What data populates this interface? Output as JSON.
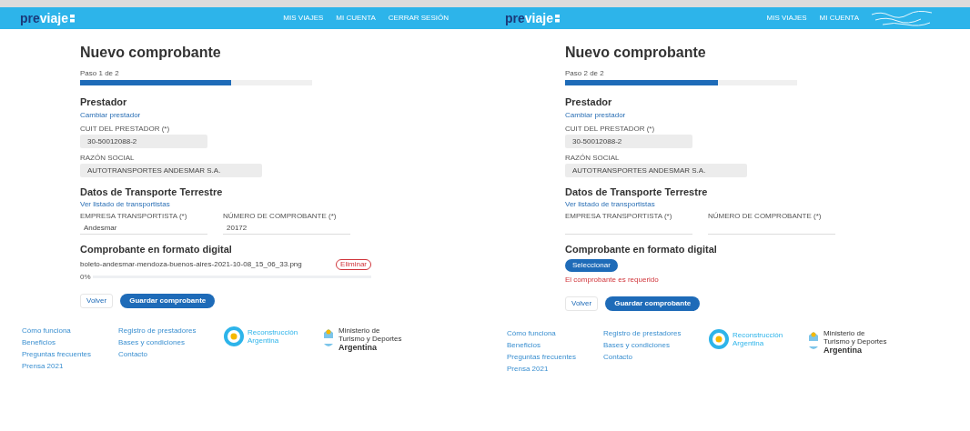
{
  "screens": [
    {
      "logo": {
        "prefix": "pre",
        "name": "viaje"
      },
      "nav": [
        {
          "label": "MIS VIAJES"
        },
        {
          "label": "MI CUENTA"
        },
        {
          "label": "CERRAR SESIÓN"
        }
      ],
      "nav_decoration": false,
      "title": "Nuevo comprobante",
      "step": {
        "label": "Paso 1 de 2",
        "level": 0.65
      },
      "provider": {
        "heading": "Prestador",
        "link": "Cambiar prestador",
        "fields": [
          {
            "label": "CUIT DEL PRESTADOR (*)",
            "value": "30-50012088-2"
          },
          {
            "label": "RAZÓN SOCIAL",
            "value": "AUTOTRANSPORTES ANDESMAR S.A."
          }
        ]
      },
      "transport": {
        "heading": "Datos de Transporte Terrestre",
        "link": "Ver listado de transportistas",
        "fields": [
          {
            "label": "EMPRESA TRANSPORTISTA (*)",
            "value": "Andesmar"
          },
          {
            "label": "NÚMERO DE COMPROBANTE (*)",
            "value": "20172"
          }
        ]
      },
      "digital": {
        "heading": "Comprobante en formato digital",
        "kind": "file",
        "file_name": "boleto-andesmar-mendoza-buenos-aires-2021-10-08_15_06_33.png",
        "remove": "Eliminar",
        "progress_label": "0%"
      },
      "buttons": [
        {
          "label": "Volver",
          "kind": "outline"
        },
        {
          "label": "Guardar comprobante",
          "kind": "primary"
        }
      ],
      "footer": {
        "col1": [
          "Cómo funciona",
          "Beneficios",
          "Preguntas frecuentes",
          "Prensa 2021"
        ],
        "col2": [
          "Registro de prestadores",
          "Bases y condiciones",
          "Contacto"
        ],
        "brand1": "Reconstrucción Argentina",
        "brand2": [
          "Ministerio de",
          "Turismo y Deportes",
          "Argentina"
        ]
      }
    },
    {
      "logo": {
        "prefix": "pre",
        "name": "viaje"
      },
      "nav": [
        {
          "label": "MIS VIAJES"
        },
        {
          "label": "MI CUENTA"
        }
      ],
      "nav_decoration": true,
      "title": "Nuevo comprobante",
      "step": {
        "label": "Paso 2 de 2",
        "level": 0.66
      },
      "provider": {
        "heading": "Prestador",
        "link": "Cambiar prestador",
        "fields": [
          {
            "label": "CUIT DEL PRESTADOR (*)",
            "value": "30-50012088-2"
          },
          {
            "label": "RAZÓN SOCIAL",
            "value": "AUTOTRANSPORTES ANDESMAR S.A."
          }
        ]
      },
      "transport": {
        "heading": "Datos de Transporte Terrestre",
        "link": "Ver listado de transportistas",
        "fields": [
          {
            "label": "EMPRESA TRANSPORTISTA (*)"
          },
          {
            "label": "NÚMERO DE COMPROBANTE (*)"
          }
        ]
      },
      "digital": {
        "heading": "Comprobante en formato digital",
        "kind": "upload",
        "upload": "Seleccionar",
        "error": "El comprobante es requerido"
      },
      "buttons": [
        {
          "label": "Volver",
          "kind": "outline"
        },
        {
          "label": "Guardar comprobante",
          "kind": "primary"
        }
      ],
      "footer": {
        "col1": [
          "Cómo funciona",
          "Beneficios",
          "Preguntas frecuentes",
          "Prensa 2021"
        ],
        "col2": [
          "Registro de prestadores",
          "Bases y condiciones",
          "Contacto"
        ],
        "brand1": "Reconstrucción Argentina",
        "brand2": [
          "Ministerio de",
          "Turismo y Deportes",
          "Argentina"
        ]
      }
    }
  ]
}
